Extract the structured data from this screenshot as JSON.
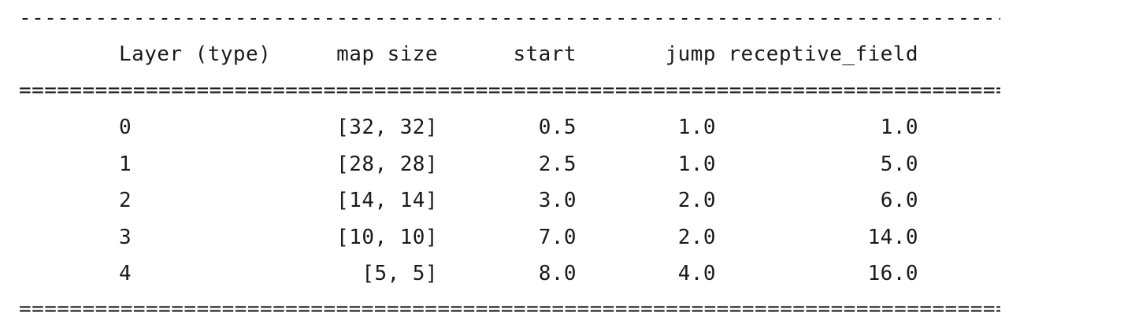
{
  "rules": {
    "top": "------------------------------------------------------------------------------",
    "header_bottom": "==============================================================================",
    "bottom": "=============================================================================="
  },
  "headers": {
    "layer": "Layer (type)",
    "map_size": "map size",
    "start": "start",
    "jump": "jump",
    "receptive_field": "receptive_field"
  },
  "rows": [
    {
      "layer": "0",
      "map_size": "[32, 32]",
      "start": "0.5",
      "jump": "1.0",
      "receptive_field": "1.0"
    },
    {
      "layer": "1",
      "map_size": "[28, 28]",
      "start": "2.5",
      "jump": "1.0",
      "receptive_field": "5.0"
    },
    {
      "layer": "2",
      "map_size": "[14, 14]",
      "start": "3.0",
      "jump": "2.0",
      "receptive_field": "6.0"
    },
    {
      "layer": "3",
      "map_size": "[10, 10]",
      "start": "7.0",
      "jump": "2.0",
      "receptive_field": "14.0"
    },
    {
      "layer": "4",
      "map_size": "[5, 5]",
      "start": "8.0",
      "jump": "4.0",
      "receptive_field": "16.0"
    }
  ]
}
